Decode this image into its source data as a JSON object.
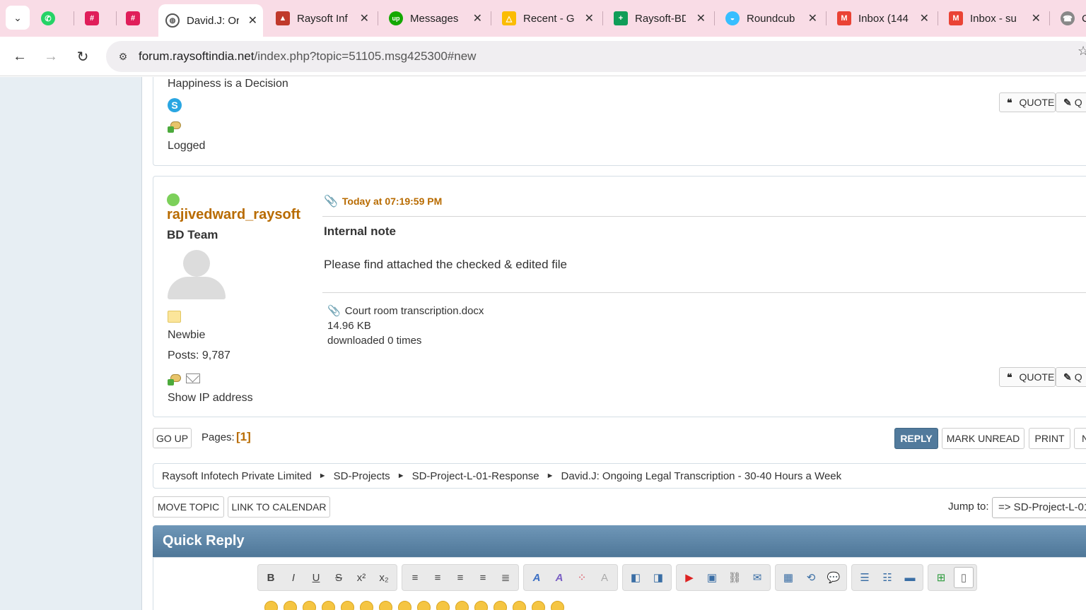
{
  "browser": {
    "tabs": [
      {
        "title": "",
        "icon": "whatsapp-icon",
        "color": "#25d366"
      },
      {
        "title": "",
        "icon": "slack-icon",
        "color": "#e01e5a"
      },
      {
        "title": "",
        "icon": "slack-icon",
        "color": "#e01e5a"
      },
      {
        "title": "David.J: Or",
        "icon": "globe-icon",
        "color": "#555555",
        "active": true
      },
      {
        "title": "Raysoft Inf",
        "icon": "raysoft-icon",
        "color": "#c0392b"
      },
      {
        "title": "Messages",
        "icon": "upwork-icon",
        "color": "#14a800"
      },
      {
        "title": "Recent - G",
        "icon": "google-drive-icon",
        "color": "#fbbc04"
      },
      {
        "title": "Raysoft-BD",
        "icon": "google-sheets-icon",
        "color": "#0f9d58"
      },
      {
        "title": "Roundcub",
        "icon": "roundcube-icon",
        "color": "#37beff"
      },
      {
        "title": "Inbox (144",
        "icon": "gmail-icon",
        "color": "#ea4335"
      },
      {
        "title": "Inbox - su",
        "icon": "gmail-icon",
        "color": "#ea4335"
      },
      {
        "title": "C",
        "icon": "phone-icon",
        "color": "#888888"
      }
    ],
    "url_host": "forum.raysoftindia.net",
    "url_rest": "/index.php?topic=51105.msg425300#new"
  },
  "prev_post": {
    "signature": "Happiness is a Decision",
    "logged": "Logged",
    "quote_label": "QUOTE",
    "quick_label": "Q"
  },
  "post": {
    "username": "rajivedward_raysoft",
    "group": "BD Team",
    "rank": "Newbie",
    "posts": "Posts: 9,787",
    "show_ip": "Show IP address",
    "time": "Today at 07:19:59 PM",
    "subject": "Internal note",
    "body": "Please find attached the checked & edited file",
    "attachment": {
      "name": "Court room transcription.docx",
      "size": "14.96 KB",
      "downloads": "downloaded 0 times"
    },
    "quote_label": "QUOTE",
    "quick_label": "Q"
  },
  "nav": {
    "go_up": "GO UP",
    "pages_label": "Pages:",
    "pages_current": "[1]",
    "reply": "REPLY",
    "mark_unread": "MARK UNREAD",
    "print": "PRINT",
    "next": "N"
  },
  "breadcrumb": [
    "Raysoft Infotech Private Limited",
    "SD-Projects",
    "SD-Project-L-01-Response",
    "David.J: Ongoing Legal Transcription - 30-40 Hours a Week"
  ],
  "actions": {
    "move_topic": "MOVE TOPIC",
    "link_calendar": "LINK TO CALENDAR",
    "jump_label": "Jump to:",
    "jump_value": "=> SD-Project-L-01"
  },
  "quick_reply": {
    "title": "Quick Reply"
  }
}
